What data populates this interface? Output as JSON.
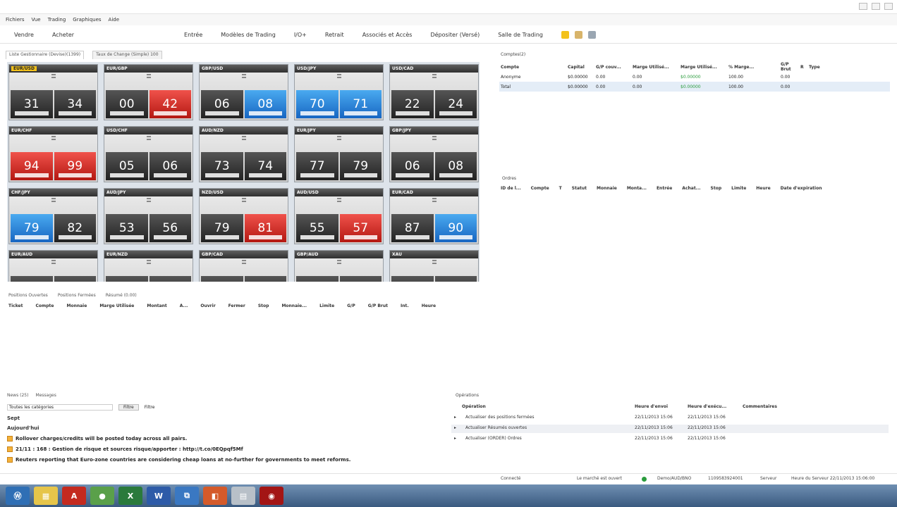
{
  "menu": [
    "Fichiers",
    "Vue",
    "Trading",
    "Graphiques",
    "Aide"
  ],
  "toolbar": {
    "items": [
      "Vendre",
      "Acheter",
      "Entrée",
      "Modèles de Trading",
      "I/O+",
      "Retrait",
      "Associés et Accès",
      "Dépositer (Versé)",
      "Salle de Trading"
    ]
  },
  "rates": {
    "tabs": [
      "Liste Gestionnaire (Devise)(1399)",
      "Taux de Change (Simple) 100"
    ],
    "tiles": [
      {
        "sym": "EUR/USD",
        "hl": true,
        "left": "31",
        "right": "34",
        "lc": "dark",
        "rc": "dark"
      },
      {
        "sym": "EUR/GBP",
        "left": "00",
        "right": "42",
        "lc": "dark",
        "rc": "red"
      },
      {
        "sym": "GBP/USD",
        "left": "06",
        "right": "08",
        "lc": "dark",
        "rc": "blue"
      },
      {
        "sym": "USD/JPY",
        "left": "70",
        "right": "71",
        "lc": "blue",
        "rc": "blue"
      },
      {
        "sym": "USD/CAD",
        "left": "22",
        "right": "24",
        "lc": "dark",
        "rc": "dark"
      },
      {
        "sym": "EUR/CHF",
        "left": "94",
        "right": "99",
        "lc": "red",
        "rc": "red"
      },
      {
        "sym": "USD/CHF",
        "left": "05",
        "right": "06",
        "lc": "dark",
        "rc": "dark"
      },
      {
        "sym": "AUD/NZD",
        "left": "73",
        "right": "74",
        "lc": "dark",
        "rc": "dark"
      },
      {
        "sym": "EUR/JPY",
        "left": "77",
        "right": "79",
        "lc": "dark",
        "rc": "dark"
      },
      {
        "sym": "GBP/JPY",
        "left": "06",
        "right": "08",
        "lc": "dark",
        "rc": "dark"
      },
      {
        "sym": "CHF/JPY",
        "left": "79",
        "right": "82",
        "lc": "blue",
        "rc": "dark"
      },
      {
        "sym": "AUD/JPY",
        "left": "53",
        "right": "56",
        "lc": "dark",
        "rc": "dark"
      },
      {
        "sym": "NZD/USD",
        "left": "79",
        "right": "81",
        "lc": "dark",
        "rc": "red"
      },
      {
        "sym": "AUD/USD",
        "left": "55",
        "right": "57",
        "lc": "dark",
        "rc": "red"
      },
      {
        "sym": "EUR/CAD",
        "left": "87",
        "right": "90",
        "lc": "dark",
        "rc": "blue"
      },
      {
        "sym": "EUR/AUD",
        "left": "",
        "right": "",
        "lc": "dark",
        "rc": "dark"
      },
      {
        "sym": "EUR/NZD",
        "left": "",
        "right": "",
        "lc": "dark",
        "rc": "dark"
      },
      {
        "sym": "GBP/CAD",
        "left": "",
        "right": "",
        "lc": "dark",
        "rc": "dark"
      },
      {
        "sym": "GBP/AUD",
        "left": "",
        "right": "",
        "lc": "dark",
        "rc": "dark"
      },
      {
        "sym": "XAU",
        "left": "",
        "right": "",
        "lc": "dark",
        "rc": "dark"
      }
    ]
  },
  "accounts": {
    "tab": "Comptes(2)",
    "headers": [
      "Compte",
      "Capital",
      "G/P couv...",
      "Marge Utilisé...",
      "Marge Utilisé...",
      "% Marge...",
      "G/P Brut",
      "R",
      "Type",
      ""
    ],
    "rows": [
      [
        "Anonyme",
        "$0.00000",
        "0.00",
        "0.00",
        "$0.00000",
        "100.00",
        "0.00",
        "",
        "",
        ""
      ],
      [
        "Total",
        "$0.00000",
        "0.00",
        "0.00",
        "$0.00000",
        "100.00",
        "0.00",
        "",
        "",
        ""
      ]
    ]
  },
  "orders": {
    "tab": "Ordres",
    "headers": [
      "ID de l...",
      "Compte",
      "T",
      "Statut",
      "Monnaie",
      "Monta...",
      "Entrée",
      "Achat...",
      "Stop",
      "Limite",
      "Heure",
      "Date d'expiration"
    ]
  },
  "trades": {
    "tabs": [
      "Positions Ouvertes",
      "Positions Fermées",
      "Résumé (0.00)"
    ],
    "headers": [
      "Ticket",
      "Compte",
      "Monnaie",
      "Marge Utilisée",
      "Montant",
      "A...",
      "Ouvrir",
      "Fermer",
      "Stop",
      "Monnaie...",
      "Limite",
      "G/P",
      "G/P Brut",
      "Int.",
      "Heure"
    ]
  },
  "news": {
    "tabs": [
      "News (25)",
      "Messages"
    ],
    "filter_value": "Toutes les catégories",
    "filter_button": "Filtre",
    "filter_label": "Filtre",
    "dates": [
      "Sept",
      "Aujourd'hui"
    ],
    "items": [
      "Rollover charges/credits will be posted today across all pairs.",
      "21/11 : 168 : Gestion de risque et sources risque/apporter : http://t.co/0EQpqf5Mf",
      "Reuters reporting that Euro-zone countries are considering cheap loans at no-further for governments to meet reforms."
    ]
  },
  "operations": {
    "tab": "Opérations",
    "headers": [
      "Opération",
      "Heure d'envoi",
      "Heure d'exécu...",
      "Commentaires"
    ],
    "rows": [
      [
        "Actualiser des positions fermées",
        "22/11/2013 15:06",
        "22/11/2013 15:06"
      ],
      [
        "Actualiser Résumés ouvertes",
        "22/11/2013 15:06",
        "22/11/2013 15:06"
      ],
      [
        "Actualiser (ORDER) Ordres",
        "22/11/2013 15:06",
        "22/11/2013 15:06"
      ]
    ]
  },
  "status": {
    "left": "Connecté",
    "market": "Le marché est ouvert",
    "server": "Demo/AUD/BNO",
    "session": "1109583924001",
    "label": "Serveur",
    "right": "Heure du Serveur 22/11/2013 15:06:00"
  },
  "taskbar": [
    "Ⓦ",
    "▦",
    "A",
    "●",
    "X",
    "W",
    "⧉",
    "◧",
    "▤",
    "◉"
  ]
}
